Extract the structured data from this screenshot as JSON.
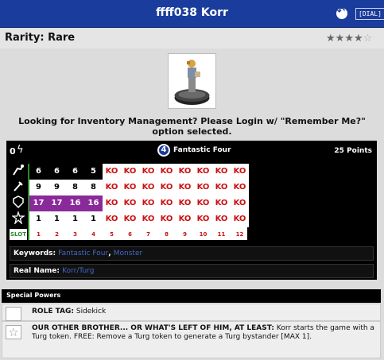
{
  "header": {
    "title": "ffff038 Korr",
    "dial_label": "[DIAL]"
  },
  "rarity": {
    "label": "Rarity: Rare",
    "stars_filled": 4,
    "stars_total": 5
  },
  "login_message": "Looking for Inventory Management? Please Login w/ \"Remember Me?\" option selected.",
  "card": {
    "points_left": "0",
    "team_logo_text": "4",
    "team": "Fantastic Four",
    "points": "25 Points",
    "rows": [
      [
        "6",
        "6",
        "6",
        "5",
        "KO",
        "KO",
        "KO",
        "KO",
        "KO",
        "KO",
        "KO",
        "KO"
      ],
      [
        "9",
        "9",
        "8",
        "8",
        "KO",
        "KO",
        "KO",
        "KO",
        "KO",
        "KO",
        "KO",
        "KO"
      ],
      [
        "17",
        "17",
        "16",
        "16",
        "KO",
        "KO",
        "KO",
        "KO",
        "KO",
        "KO",
        "KO",
        "KO"
      ],
      [
        "1",
        "1",
        "1",
        "1",
        "KO",
        "KO",
        "KO",
        "KO",
        "KO",
        "KO",
        "KO",
        "KO"
      ]
    ],
    "slot_label": "SLOT",
    "slots": [
      "1",
      "2",
      "3",
      "4",
      "5",
      "6",
      "7",
      "8",
      "9",
      "10",
      "11",
      "12"
    ],
    "keywords_label": "Keywords:",
    "keywords": [
      "Fantastic Four",
      "Monster"
    ],
    "keywords_sep": ",",
    "realname_label": "Real Name:",
    "realname": "Korr/Turg"
  },
  "special_powers": {
    "heading": "Special Powers",
    "items": [
      {
        "title": "ROLE TAG:",
        "text": "Sidekick"
      },
      {
        "title": "OUR OTHER BROTHER... OR WHAT'S LEFT OF HIM, AT LEAST:",
        "text": "Korr starts the game with a Turg token. FREE: Remove a Turg token to generate a Turg bystander [MAX 1]."
      }
    ]
  },
  "colors": {
    "title_bar": "#1a3c9c",
    "purple_cell": "#8a2a9a",
    "ko_red": "#cc1111",
    "slot_green": "#2a8a2a",
    "link_blue": "#3f6ac8"
  }
}
